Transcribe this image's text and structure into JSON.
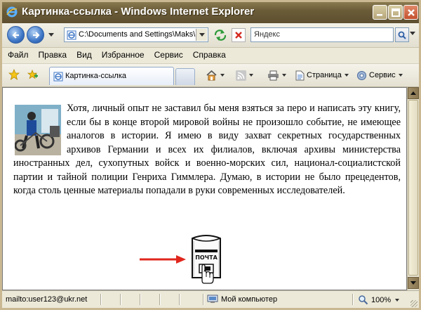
{
  "window": {
    "title": "Картинка-ссылка - Windows Internet Explorer"
  },
  "address_bar": {
    "url": "C:\\Documents and Settings\\Maks\\F",
    "search_value": "Яндекс"
  },
  "menu": [
    "Файл",
    "Правка",
    "Вид",
    "Избранное",
    "Сервис",
    "Справка"
  ],
  "tab": {
    "label": "Картинка-ссылка"
  },
  "toolbar": {
    "page_label": "Страница",
    "tools_label": "Сервис"
  },
  "content": {
    "paragraph_top": "Хотя, личный опыт не заставил бы меня взяться за перо и написать эту книгу, если бы в конце второй мировой войны не произошло событие, не имеющее аналогов в истории.  Я имею в виду захват секретных государственных архивов Германии и всех их филиалов, включая архивы министерства иностранных дел, сухопутных войск и военно-морских сил, национал-социалистской партии и тайной полиции Генриха Гиммлера. Думаю, в истории не было прецедентов, когда столь ценные материалы попадали в руки современных исследователей.",
    "mailbox_label": "ПОЧТА"
  },
  "status": {
    "link_url": "mailto:user123@ukr.net",
    "zone": "Мой компьютер",
    "zoom": "100%"
  },
  "colors": {
    "title_bar": "#6b5c38",
    "arrow": "#e0261d",
    "accent_blue": "#3e76c6"
  }
}
